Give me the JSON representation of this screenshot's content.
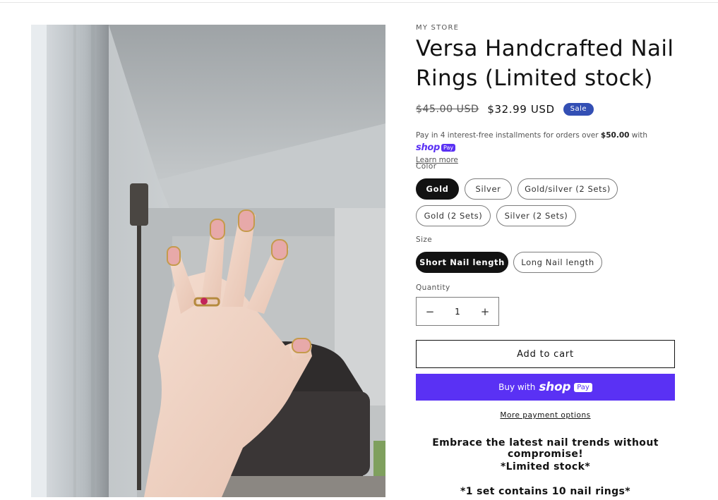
{
  "product": {
    "vendor": "MY STORE",
    "title": "Versa Handcrafted Nail Rings (Limited stock)",
    "compare_price": "$45.00 USD",
    "sale_price": "$32.99 USD",
    "badge": "Sale"
  },
  "installments": {
    "prefix": "Pay in 4 interest-free installments for orders over",
    "threshold": "$50.00",
    "suffix": "with",
    "shop_word": "shop",
    "pay_chip": "Pay",
    "learn_more": "Learn more"
  },
  "color": {
    "label": "Color",
    "options": [
      "Gold",
      "Silver",
      "Gold/silver (2 Sets)",
      "Gold (2 Sets)",
      "Silver (2 Sets)"
    ],
    "selected": "Gold"
  },
  "size": {
    "label": "Size",
    "options": [
      "Short Nail length",
      "Long Nail length"
    ],
    "selected": "Short Nail length"
  },
  "quantity": {
    "label": "Quantity",
    "value": "1",
    "minus": "−",
    "plus": "+"
  },
  "buttons": {
    "add_to_cart": "Add to cart",
    "buy_with": "Buy with",
    "shop_word": "shop",
    "pay_chip": "Pay",
    "more_payment": "More payment options"
  },
  "description": [
    "Embrace the latest nail trends without compromise!",
    "*Limited stock*",
    "*1 set contains 10 nail rings*"
  ],
  "colors": {
    "accent_shop": "#5a31f4",
    "sale_badge": "#334fb4",
    "text": "#121212"
  }
}
